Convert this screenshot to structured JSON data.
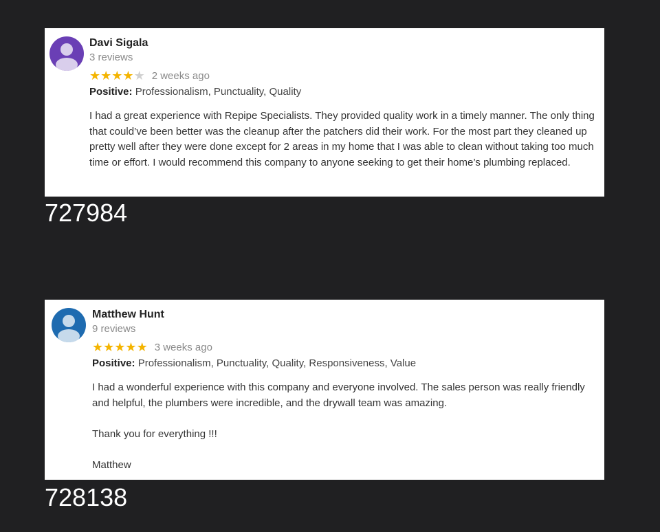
{
  "reviews": [
    {
      "name": "Davi Sigala",
      "review_count": "3 reviews",
      "rating": 4,
      "max_rating": 5,
      "time_ago": "2 weeks ago",
      "positive_label": "Positive:",
      "positive_values": "Professionalism, Punctuality, Quality",
      "body_paragraphs": [
        "I had a great experience with Repipe Specialists. They provided quality work in a timely manner. The only thing that could’ve been better was the cleanup after the patchers did their work. For the most part they cleaned up pretty well after they were done except for 2 areas in my home that I was able to clean without taking too much time or effort. I would recommend this company to anyone seeking to get their home’s plumbing replaced."
      ],
      "id_label": "727984",
      "avatar_color": "#6a3fb5",
      "avatar_icon": "person-icon"
    },
    {
      "name": "Matthew Hunt",
      "review_count": "9 reviews",
      "rating": 5,
      "max_rating": 5,
      "time_ago": "3 weeks ago",
      "positive_label": "Positive:",
      "positive_values": "Professionalism, Punctuality, Quality, Responsiveness, Value",
      "body_paragraphs": [
        "I had a wonderful experience with this company and everyone involved. The sales person was really friendly and helpful, the plumbers were incredible, and the drywall team was amazing.",
        "Thank you for everything !!!",
        "Matthew"
      ],
      "id_label": "728138",
      "avatar_color": "#1e6bb0",
      "avatar_icon": "person-icon"
    }
  ],
  "colors": {
    "background": "#202022",
    "star_on": "#f4b400",
    "star_off": "#d0d0d0"
  }
}
